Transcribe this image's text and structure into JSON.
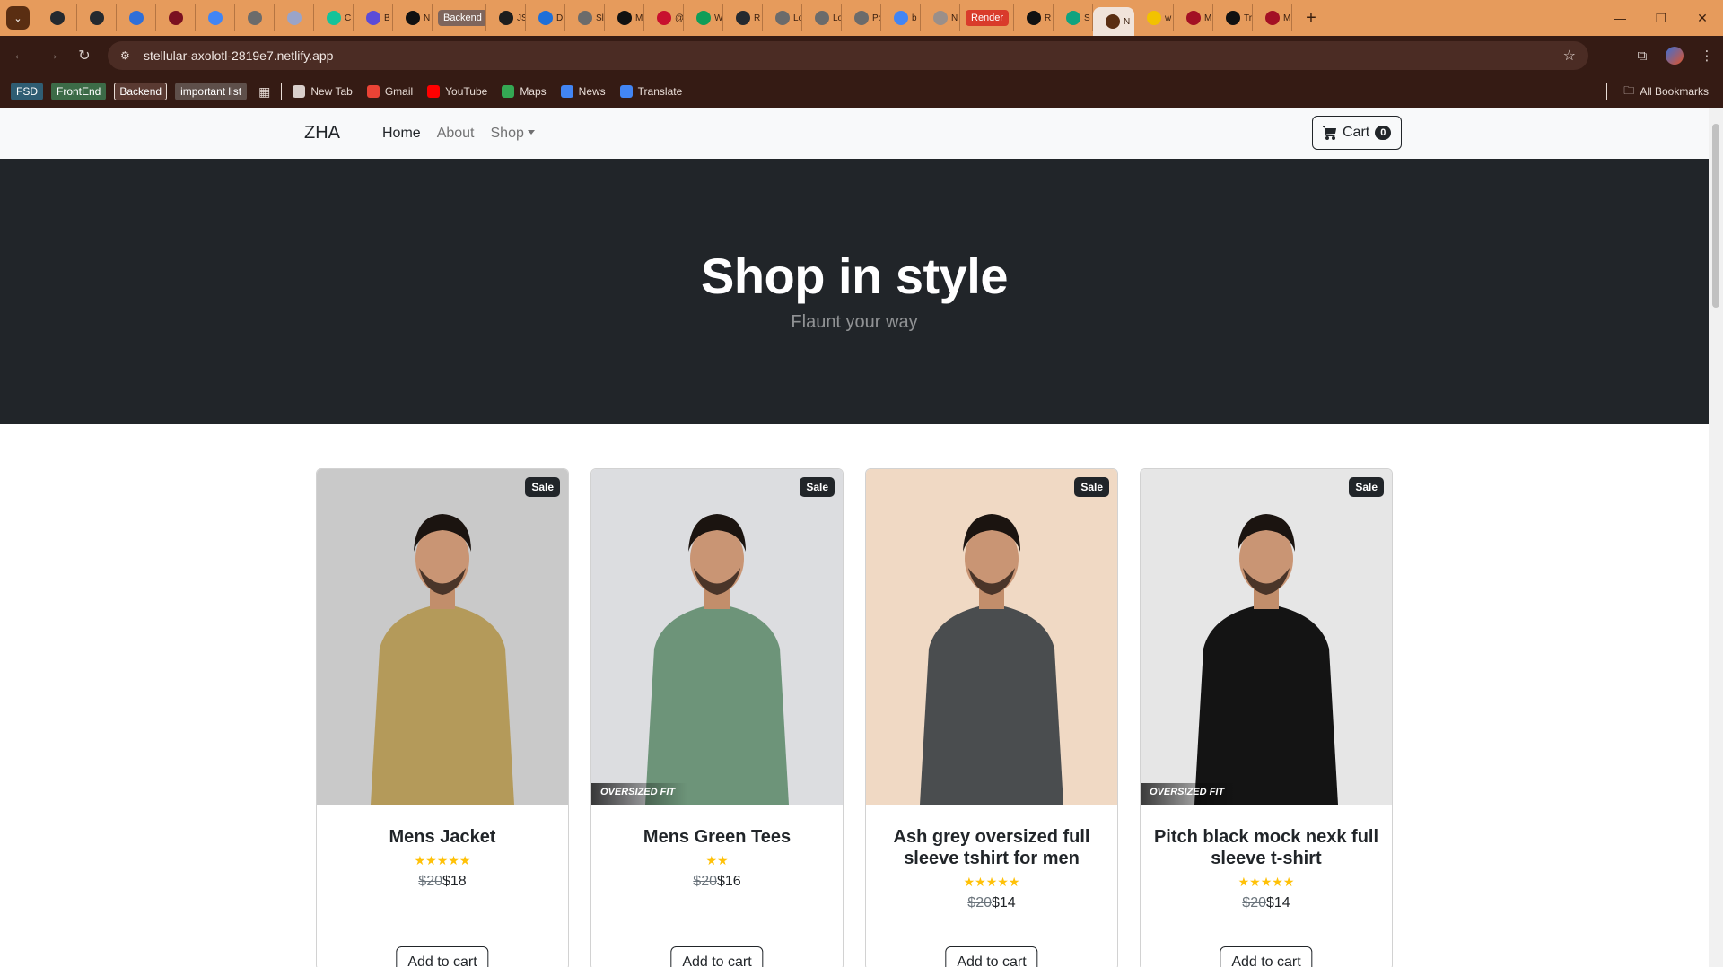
{
  "browser": {
    "tabs": [
      {
        "icon": "github-icon",
        "color": "#24292f",
        "label": ""
      },
      {
        "icon": "github-icon",
        "color": "#24292f",
        "label": ""
      },
      {
        "icon": "bookmark-icon",
        "color": "#2f6fd8",
        "label": ""
      },
      {
        "icon": "record-icon",
        "color": "#7a1020",
        "label": ""
      },
      {
        "icon": "google-icon",
        "color": "#4285f4",
        "label": ""
      },
      {
        "icon": "globe-icon",
        "color": "#6b6b6b",
        "label": ""
      },
      {
        "icon": "swirl-icon",
        "color": "#9aa4c9",
        "label": ""
      },
      {
        "icon": "grammarly-icon",
        "color": "#15c39a",
        "label": "C"
      },
      {
        "icon": "bolt-icon",
        "color": "#5b4bd8",
        "label": "B"
      },
      {
        "icon": "openai-icon",
        "color": "#111111",
        "label": "N"
      },
      {
        "icon": "tag-icon",
        "color": "#7e655c",
        "label": "Backend",
        "pill": true
      },
      {
        "icon": "js-icon",
        "color": "#1d1d1d",
        "label": "JS"
      },
      {
        "icon": "diagram-icon",
        "color": "#1e6fd8",
        "label": "D"
      },
      {
        "icon": "sheet-icon",
        "color": "#6b6b6b",
        "label": "Sl"
      },
      {
        "icon": "medium-icon",
        "color": "#111111",
        "label": "M"
      },
      {
        "icon": "reader-icon",
        "color": "#c8102e",
        "label": "@"
      },
      {
        "icon": "leaf-icon",
        "color": "#0f9d58",
        "label": "W"
      },
      {
        "icon": "github-icon",
        "color": "#24292f",
        "label": "R"
      },
      {
        "icon": "globe-icon",
        "color": "#6b6b6b",
        "label": "Lo"
      },
      {
        "icon": "globe-icon",
        "color": "#6b6b6b",
        "label": "Lo"
      },
      {
        "icon": "globe-icon",
        "color": "#6b6b6b",
        "label": "Po"
      },
      {
        "icon": "google-icon",
        "color": "#4285f4",
        "label": "b"
      },
      {
        "icon": "globe-icon",
        "color": "#9a8f8a",
        "label": "N"
      },
      {
        "icon": "tag-icon",
        "color": "#d93b2b",
        "label": "Render",
        "pill": true
      },
      {
        "icon": "mascot-icon",
        "color": "#111111",
        "label": "R"
      },
      {
        "icon": "diamond-icon",
        "color": "#10a37f",
        "label": "S"
      },
      {
        "icon": "site-icon",
        "color": "#5a2e12",
        "label": "N",
        "active": true
      },
      {
        "icon": "bulb-icon",
        "color": "#f2c200",
        "label": "w"
      },
      {
        "icon": "screen-icon",
        "color": "#a31024",
        "label": "M"
      },
      {
        "icon": "check-icon",
        "color": "#111111",
        "label": "Tr"
      },
      {
        "icon": "screen-icon",
        "color": "#a31024",
        "label": "M"
      }
    ],
    "url": "stellular-axolotl-2819e7.netlify.app",
    "bookmarks": {
      "tags": [
        {
          "label": "FSD"
        },
        {
          "label": "FrontEnd"
        },
        {
          "label": "Backend"
        },
        {
          "label": "important list"
        }
      ],
      "items": [
        {
          "label": "New Tab",
          "icon": "globe-icon",
          "color": "#d9cfcb"
        },
        {
          "label": "Gmail",
          "icon": "gmail-icon",
          "color": "#ea4335"
        },
        {
          "label": "YouTube",
          "icon": "youtube-icon",
          "color": "#ff0000"
        },
        {
          "label": "Maps",
          "icon": "maps-icon",
          "color": "#34a853"
        },
        {
          "label": "News",
          "icon": "news-icon",
          "color": "#4285f4"
        },
        {
          "label": "Translate",
          "icon": "translate-icon",
          "color": "#4285f4"
        }
      ],
      "all_label": "All Bookmarks"
    }
  },
  "site": {
    "brand": "ZHA",
    "nav": {
      "home": "Home",
      "about": "About",
      "shop": "Shop"
    },
    "cart": {
      "label": "Cart",
      "count": "0"
    },
    "hero": {
      "title": "Shop in style",
      "subtitle": "Flaunt your way"
    },
    "products": [
      {
        "name": "Mens Jacket",
        "badge": "Sale",
        "rating": 5,
        "stars": "★★★★★",
        "old_price": "$20",
        "price": "$18",
        "button": "Add to cart",
        "garment_color": "#b49a5a",
        "bg": "#c9c9c9",
        "oversized": ""
      },
      {
        "name": "Mens Green Tees",
        "badge": "Sale",
        "rating": 2,
        "stars": "★★",
        "old_price": "$20",
        "price": "$16",
        "button": "Add to cart",
        "garment_color": "#6d9479",
        "bg": "#dcdde0",
        "oversized": "OVERSIZED FIT"
      },
      {
        "name": "Ash grey oversized full sleeve tshirt for men",
        "badge": "Sale",
        "rating": 5,
        "stars": "★★★★★",
        "old_price": "$20",
        "price": "$14",
        "button": "Add to cart",
        "garment_color": "#4a4d4f",
        "bg": "#f0d9c4",
        "oversized": ""
      },
      {
        "name": "Pitch black mock nexk full sleeve t-shirt",
        "badge": "Sale",
        "rating": 5,
        "stars": "★★★★★",
        "old_price": "$20",
        "price": "$14",
        "button": "Add to cart",
        "garment_color": "#141414",
        "bg": "#e6e6e6",
        "oversized": "OVERSIZED FIT"
      }
    ]
  }
}
